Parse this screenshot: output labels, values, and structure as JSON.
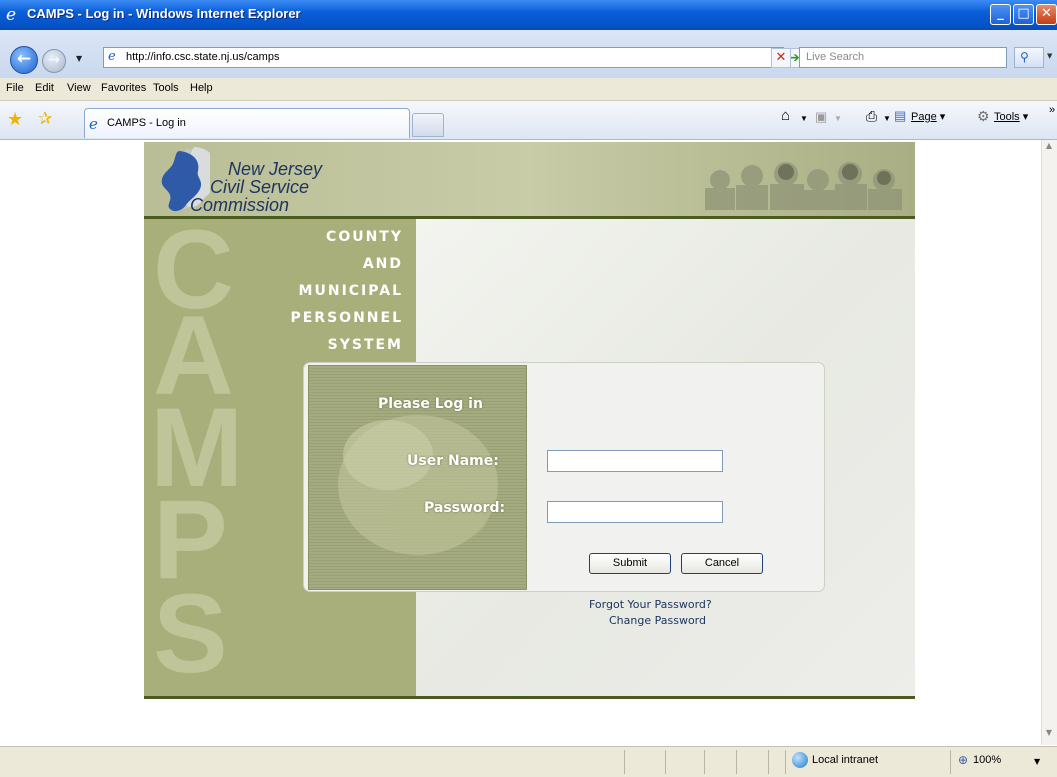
{
  "window": {
    "title": "CAMPS - Log in - Windows Internet Explorer"
  },
  "address": {
    "url": "http://info.csc.state.nj.us/camps",
    "search_placeholder": "Live Search"
  },
  "menu": [
    "File",
    "Edit",
    "View",
    "Favorites",
    "Tools",
    "Help"
  ],
  "tab": {
    "label": "CAMPS - Log in"
  },
  "commands": {
    "page": "Page",
    "tools": "Tools"
  },
  "status": {
    "zone": "Local intranet",
    "zoom": "100%"
  },
  "page": {
    "org_line1": "New Jersey",
    "org_line2": "Civil Service",
    "org_line3": "Commission",
    "big_letters": [
      "C",
      "A",
      "M",
      "P",
      "S"
    ],
    "system_words": [
      "COUNTY",
      "AND",
      "MUNICIPAL",
      "PERSONNEL",
      "SYSTEM"
    ],
    "login_heading": "Please Log in",
    "username_label": "User Name:",
    "password_label": "Password:",
    "username_value": "",
    "password_value": "",
    "submit_label": "Submit",
    "cancel_label": "Cancel",
    "forgot_link": "Forgot Your Password?",
    "change_link": "Change Password"
  }
}
